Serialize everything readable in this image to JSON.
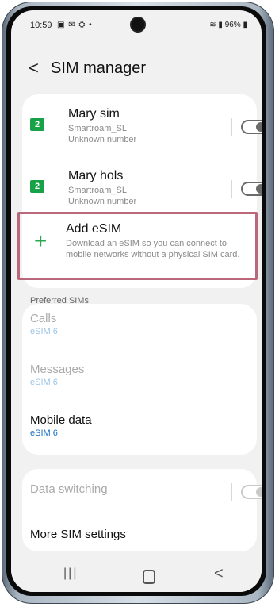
{
  "status_bar": {
    "time": "10:59",
    "left_icons": "▣ ✉ ⛭ •",
    "right_text": "96%"
  },
  "header": {
    "title": "SIM manager"
  },
  "sims": [
    {
      "name": "Mary sim",
      "carrier": "Smartroam_SL",
      "number": "Unknown number",
      "badge": "2"
    },
    {
      "name": "Mary hols",
      "carrier": "Smartroam_SL",
      "number": "Unknown number",
      "badge": "2"
    }
  ],
  "add_esim": {
    "title": "Add eSIM",
    "description": "Download an eSIM so you can connect to mobile networks without a physical SIM card."
  },
  "preferred": {
    "label": "Preferred SIMs",
    "items": [
      {
        "title": "Calls",
        "value": "eSIM 6"
      },
      {
        "title": "Messages",
        "value": "eSIM 6"
      },
      {
        "title": "Mobile data",
        "value": "eSIM 6"
      }
    ]
  },
  "bottom": {
    "data_switching": "Data switching",
    "more_settings": "More SIM settings"
  },
  "colors": {
    "sim_green": "#18a248",
    "accent_blue": "#1a6fc1",
    "highlight_border": "#b8687a"
  }
}
